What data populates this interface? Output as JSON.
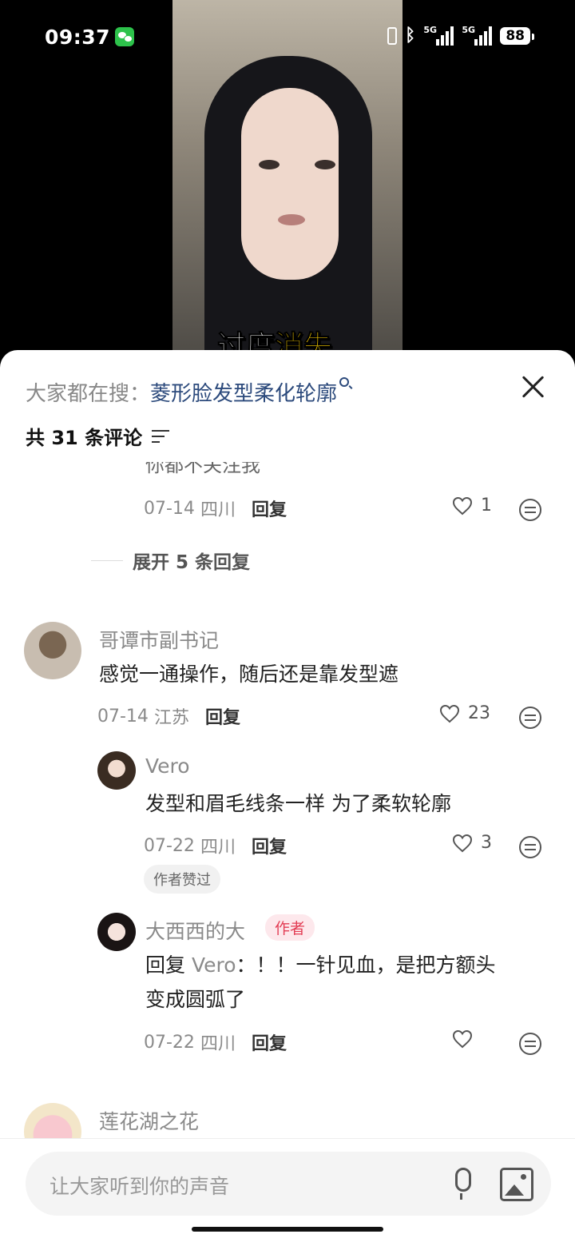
{
  "status_bar": {
    "time": "09:37",
    "battery": "88",
    "net1": "5G",
    "net2": "5G"
  },
  "video": {
    "caption_part1": "过度",
    "caption_part2": "消失"
  },
  "comments_sheet": {
    "search_prefix": "大家都在搜：",
    "search_query": "菱形脸发型柔化轮廓",
    "count_label": "共 31 条评论",
    "cut_text": "你都不关注我",
    "top_meta": {
      "date": "07-14",
      "location": "四川",
      "reply": "回复",
      "likes": "1"
    },
    "expand_replies": "展开 5 条回复",
    "comments": [
      {
        "username": "哥谭市副书记",
        "text": "感觉一通操作，随后还是靠发型遮",
        "date": "07-14",
        "location": "江苏",
        "reply": "回复",
        "likes": "23"
      },
      {
        "username": "Vero",
        "text": "发型和眉毛线条一样 为了柔软轮廓",
        "date": "07-22",
        "location": "四川",
        "reply": "回复",
        "likes": "3",
        "badge": "作者赞过"
      },
      {
        "username": "大西西的大",
        "author_badge": "作者",
        "reply_prefix": "回复",
        "reply_to": "Vero",
        "text_line1": "：！！一针见血，是把方额头",
        "text_line2": "变成圆弧了",
        "date": "07-22",
        "location": "四川",
        "reply": "回复"
      },
      {
        "username": "莲花湖之花"
      }
    ]
  },
  "input": {
    "placeholder": "让大家听到你的声音"
  }
}
